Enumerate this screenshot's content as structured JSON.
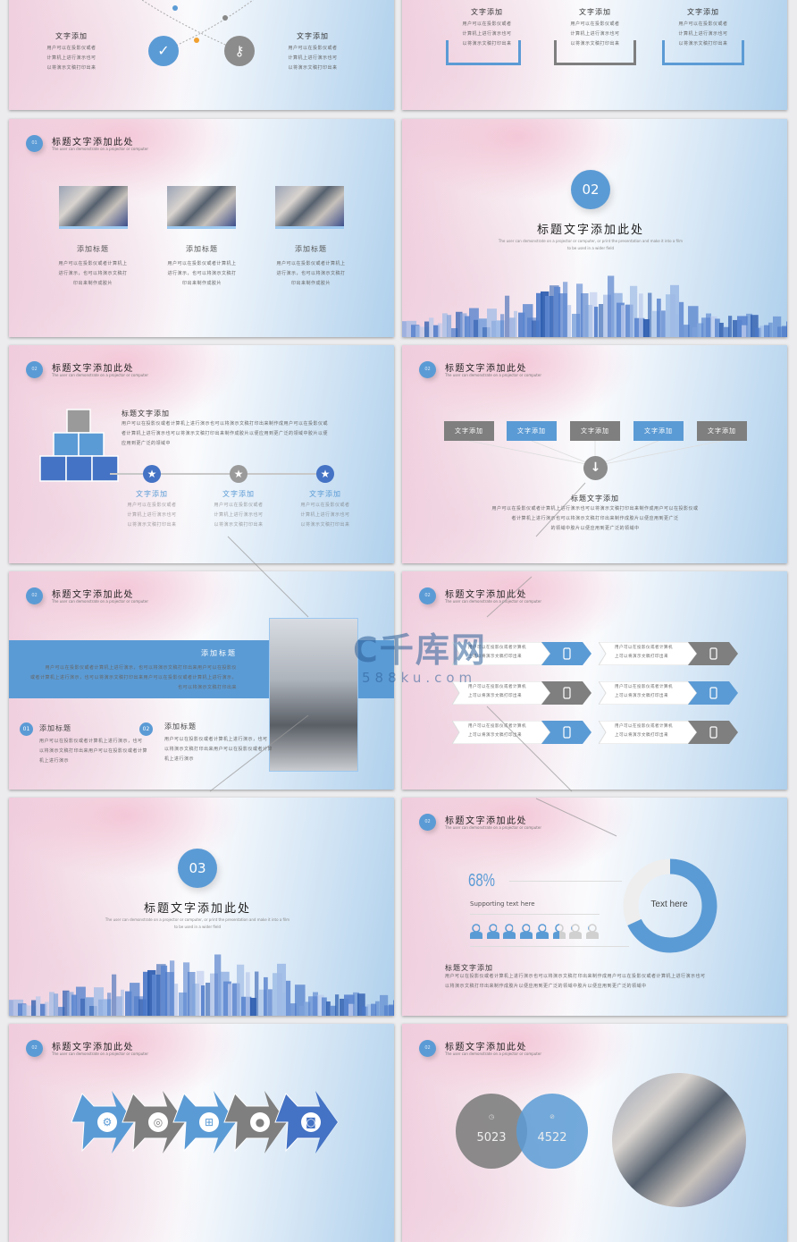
{
  "common": {
    "slide_title": "标题文字添加此处",
    "slide_subtitle": "The user can demonstrate on a projector or computer",
    "section_sub1": "The user can demonstrate on a projector or computer, or print the presentation and make it into a film",
    "section_sub2": "to be used in a wider field",
    "lines3": [
      "用户可以在投影仪或者",
      "计算机上进行演示也可",
      "以将演示文稿打印出来"
    ],
    "colors": {
      "blue": "#5b9bd5",
      "gray": "#7f7f7f",
      "dark_blue": "#4472c4"
    }
  },
  "s1": {
    "left_title": "文字添加",
    "right_title": "文字添加",
    "icons": [
      "check-icon",
      "key-icon"
    ]
  },
  "s2": {
    "cols": [
      {
        "title": "文字添加"
      },
      {
        "title": "文字添加"
      },
      {
        "title": "文字添加"
      }
    ]
  },
  "s3": {
    "num": "01",
    "cards": [
      {
        "title": "添加标题",
        "lines": [
          "用户可以在投影仪或者计算机上",
          "进行演示，也可以将演示文稿打",
          "印出来制作成胶片"
        ]
      },
      {
        "title": "添加标题",
        "lines": [
          "用户可以在投影仪或者计算机上",
          "进行演示，也可以将演示文稿打",
          "印出来制作成胶片"
        ]
      },
      {
        "title": "添加标题",
        "lines": [
          "用户可以在投影仪或者计算机上",
          "进行演示，也可以将演示文稿打",
          "印出来制作成胶片"
        ]
      }
    ]
  },
  "s4": {
    "num": "02"
  },
  "s5": {
    "num": "02",
    "heading": "标题文字添加",
    "lines": [
      "用户可以在投影仪或者计算机上进行演示也可以将演示文稿打印出来制作成用户可以在投影仪或",
      "者计算机上进行演示也可以将演示文稿打印出来制作成胶片以便应用到更广泛的领域中胶片以便",
      "应用到更广泛的领域中"
    ],
    "steps": [
      {
        "title": "文字添加"
      },
      {
        "title": "文字添加"
      },
      {
        "title": "文字添加"
      }
    ]
  },
  "s6": {
    "num": "02",
    "boxes": [
      "文字添加",
      "文字添加",
      "文字添加",
      "文字添加",
      "文字添加"
    ],
    "heading": "标题文字添加",
    "lines": [
      "用户可以在投影仪或者计算机上进行演示也可以将演示文稿打印出来制作成用户可以在投影仪或",
      "者计算机上进行演示也可以将演示文稿打印出来制作成胶片以便应用到更广泛",
      "的领域中胶片以便应用到更广泛的领域中"
    ]
  },
  "s7": {
    "num": "02",
    "band_title": "添加标题",
    "band_lines": [
      "用户可以在投影仪或者计算机上进行演示，也可以将演示文稿打印出来用户可以在投影仪",
      "或者计算机上进行演示，也可以将演示文稿打印出来用户可以在投影仪或者计算机上进行演示，",
      "也可以将演示文稿打印出来"
    ],
    "items": [
      {
        "num": "01",
        "title": "添加标题",
        "lines": [
          "用户可以在投影仪或者计算机上进行演示，也可",
          "以将演示文稿打印出来用户可以在投影仪或者计算",
          "机上进行演示"
        ]
      },
      {
        "num": "02",
        "title": "添加标题",
        "lines": [
          "用户可以在投影仪或者计算机上进行演示，也可",
          "以将演示文稿打印出来用户可以在投影仪或者计算",
          "机上进行演示"
        ]
      }
    ]
  },
  "s8": {
    "num": "02",
    "rows": [
      {
        "l1": "用户可以在投影仪或者计算机",
        "l2": "上可以将演示文稿打印出来",
        "color": "blue"
      },
      {
        "l1": "用户可以在投影仪或者计算机",
        "l2": "上可以将演示文稿打印出来",
        "color": "gray"
      },
      {
        "l1": "用户可以在投影仪或者计算机",
        "l2": "上可以将演示文稿打印出来",
        "color": "gray"
      },
      {
        "l1": "用户可以在投影仪或者计算机",
        "l2": "上可以将演示文稿打印出来",
        "color": "blue"
      },
      {
        "l1": "用户可以在投影仪或者计算机",
        "l2": "上可以将演示文稿打印出来",
        "color": "blue"
      },
      {
        "l1": "用户可以在投影仪或者计算机",
        "l2": "上可以将演示文稿打印出来",
        "color": "gray"
      }
    ]
  },
  "s9": {
    "num": "03"
  },
  "s10": {
    "num": "02",
    "percent": "68%",
    "percent_value": 68,
    "supporting": "Supporting text here",
    "people_filled": 5.5,
    "people_total": 8,
    "donut_label": "Text here",
    "donut_fraction": 0.68,
    "heading": "标题文字添加",
    "lines": [
      "用户可以在投影仪或者计算机上进行演示也可以将演示文稿打印出来制作成用户可以在投影仪或者计算机上进行演示也可",
      "以将演示文稿打印出来制作成胶片以便应用到更广泛的领域中胶片以便应用到更广泛的领域中"
    ]
  },
  "s11": {
    "num": "02",
    "arrows": [
      {
        "icon": "gear-icon",
        "color": "#5b9bd5"
      },
      {
        "icon": "camera-shutter-icon",
        "color": "#7f7f7f"
      },
      {
        "icon": "windows-icon",
        "color": "#5b9bd5"
      },
      {
        "icon": "apple-icon",
        "color": "#7f7f7f"
      },
      {
        "icon": "instagram-icon",
        "color": "#4472c4"
      }
    ]
  },
  "s12": {
    "num": "02",
    "stat1": "5023",
    "stat2": "4522"
  },
  "watermark": {
    "logo": "千库网",
    "url": "588ku.com"
  }
}
